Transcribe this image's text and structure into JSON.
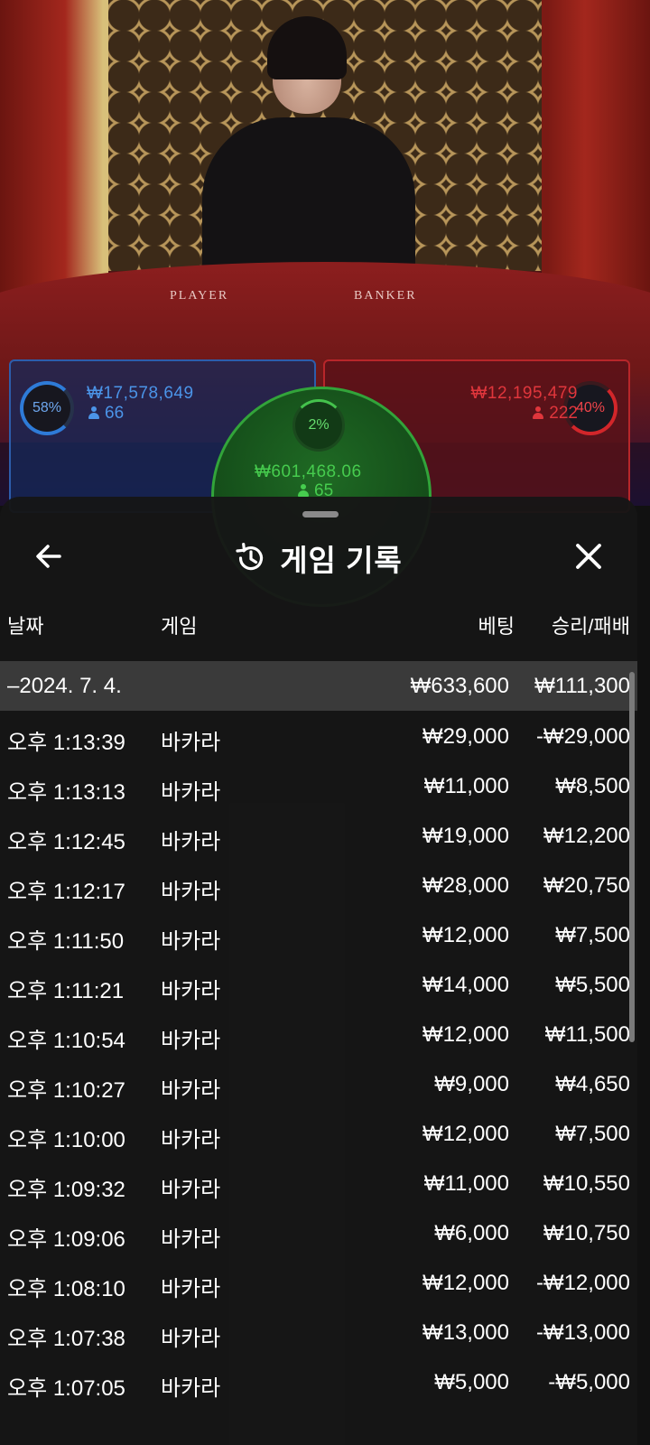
{
  "live": {
    "table_labels": {
      "player": "PLAYER",
      "banker": "BANKER"
    },
    "player": {
      "percent": "58%",
      "amount": "₩17,578,649",
      "count": "66"
    },
    "banker": {
      "percent": "40%",
      "amount": "₩12,195,479",
      "count": "222"
    },
    "tie": {
      "percent": "2%",
      "amount": "₩601,468.06",
      "count": "65"
    },
    "colors": {
      "player": "#2e7bd8",
      "banker": "#d2262a",
      "tie": "#44c24c"
    }
  },
  "sheet": {
    "title": "게임 기록",
    "title_icon": "history-icon",
    "back_icon": "arrow-left-icon",
    "close_icon": "close-icon",
    "columns": {
      "date": "날짜",
      "game": "게임",
      "bet": "베팅",
      "result": "승리/패배"
    },
    "date_group": {
      "label": "–2024. 7. 4.",
      "bet": "₩633,600",
      "result": "₩111,300"
    },
    "rows": [
      {
        "time": "오후 1:13:39",
        "game": "바카라",
        "bet": "₩29,000",
        "result": "-₩29,000"
      },
      {
        "time": "오후 1:13:13",
        "game": "바카라",
        "bet": "₩11,000",
        "result": "₩8,500"
      },
      {
        "time": "오후 1:12:45",
        "game": "바카라",
        "bet": "₩19,000",
        "result": "₩12,200"
      },
      {
        "time": "오후 1:12:17",
        "game": "바카라",
        "bet": "₩28,000",
        "result": "₩20,750"
      },
      {
        "time": "오후 1:11:50",
        "game": "바카라",
        "bet": "₩12,000",
        "result": "₩7,500"
      },
      {
        "time": "오후 1:11:21",
        "game": "바카라",
        "bet": "₩14,000",
        "result": "₩5,500"
      },
      {
        "time": "오후 1:10:54",
        "game": "바카라",
        "bet": "₩12,000",
        "result": "₩11,500"
      },
      {
        "time": "오후 1:10:27",
        "game": "바카라",
        "bet": "₩9,000",
        "result": "₩4,650"
      },
      {
        "time": "오후 1:10:00",
        "game": "바카라",
        "bet": "₩12,000",
        "result": "₩7,500"
      },
      {
        "time": "오후 1:09:32",
        "game": "바카라",
        "bet": "₩11,000",
        "result": "₩10,550"
      },
      {
        "time": "오후 1:09:06",
        "game": "바카라",
        "bet": "₩6,000",
        "result": "₩10,750"
      },
      {
        "time": "오후 1:08:10",
        "game": "바카라",
        "bet": "₩12,000",
        "result": "-₩12,000"
      },
      {
        "time": "오후 1:07:38",
        "game": "바카라",
        "bet": "₩13,000",
        "result": "-₩13,000"
      },
      {
        "time": "오후 1:07:05",
        "game": "바카라",
        "bet": "₩5,000",
        "result": "-₩5,000"
      }
    ]
  }
}
